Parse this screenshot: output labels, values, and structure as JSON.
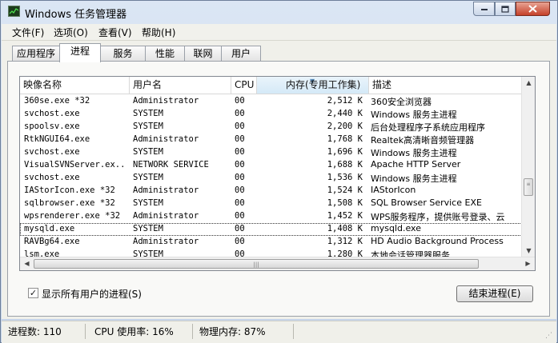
{
  "window": {
    "title": "Windows 任务管理器"
  },
  "menu": [
    "文件(F)",
    "选项(O)",
    "查看(V)",
    "帮助(H)"
  ],
  "tabs": [
    "应用程序",
    "进程",
    "服务",
    "性能",
    "联网",
    "用户"
  ],
  "active_tab": "进程",
  "columns": {
    "name": "映像名称",
    "user": "用户名",
    "cpu": "CPU",
    "memory": "内存(专用工作集)",
    "description": "描述"
  },
  "processes": [
    {
      "name": "360se.exe *32",
      "user": "Administrator",
      "cpu": "00",
      "memory": "2,512 K",
      "description": "360安全浏览器"
    },
    {
      "name": "svchost.exe",
      "user": "SYSTEM",
      "cpu": "00",
      "memory": "2,440 K",
      "description": "Windows 服务主进程"
    },
    {
      "name": "spoolsv.exe",
      "user": "SYSTEM",
      "cpu": "00",
      "memory": "2,200 K",
      "description": "后台处理程序子系统应用程序"
    },
    {
      "name": "RtkNGUI64.exe",
      "user": "Administrator",
      "cpu": "00",
      "memory": "1,768 K",
      "description": "Realtek高清晰音频管理器"
    },
    {
      "name": "svchost.exe",
      "user": "SYSTEM",
      "cpu": "00",
      "memory": "1,696 K",
      "description": "Windows 服务主进程"
    },
    {
      "name": "VisualSVNServer.ex...",
      "user": "NETWORK SERVICE",
      "cpu": "00",
      "memory": "1,688 K",
      "description": "Apache HTTP Server"
    },
    {
      "name": "svchost.exe",
      "user": "SYSTEM",
      "cpu": "00",
      "memory": "1,536 K",
      "description": "Windows 服务主进程"
    },
    {
      "name": "IAStorIcon.exe *32",
      "user": "Administrator",
      "cpu": "00",
      "memory": "1,524 K",
      "description": "IAStorIcon"
    },
    {
      "name": "sqlbrowser.exe *32",
      "user": "SYSTEM",
      "cpu": "00",
      "memory": "1,508 K",
      "description": "SQL Browser Service EXE"
    },
    {
      "name": "wpsrenderer.exe *32",
      "user": "Administrator",
      "cpu": "00",
      "memory": "1,452 K",
      "description": "WPS服务程序，提供账号登录、云"
    },
    {
      "name": "mysqld.exe",
      "user": "SYSTEM",
      "cpu": "00",
      "memory": "1,408 K",
      "description": "mysqld.exe"
    },
    {
      "name": "RAVBg64.exe",
      "user": "Administrator",
      "cpu": "00",
      "memory": "1,312 K",
      "description": "HD Audio Background Process"
    },
    {
      "name": "lsm.exe",
      "user": "SYSTEM",
      "cpu": "00",
      "memory": "1,280 K",
      "description": "本地会话管理器服务"
    }
  ],
  "selected_process": "mysqld.exe",
  "show_all_users": {
    "label": "显示所有用户的进程(S)",
    "checked": true
  },
  "end_process_button": "结束进程(E)",
  "status": {
    "processes": "进程数: 110",
    "cpu": "CPU 使用率: 16%",
    "memory": "物理内存: 87%"
  }
}
